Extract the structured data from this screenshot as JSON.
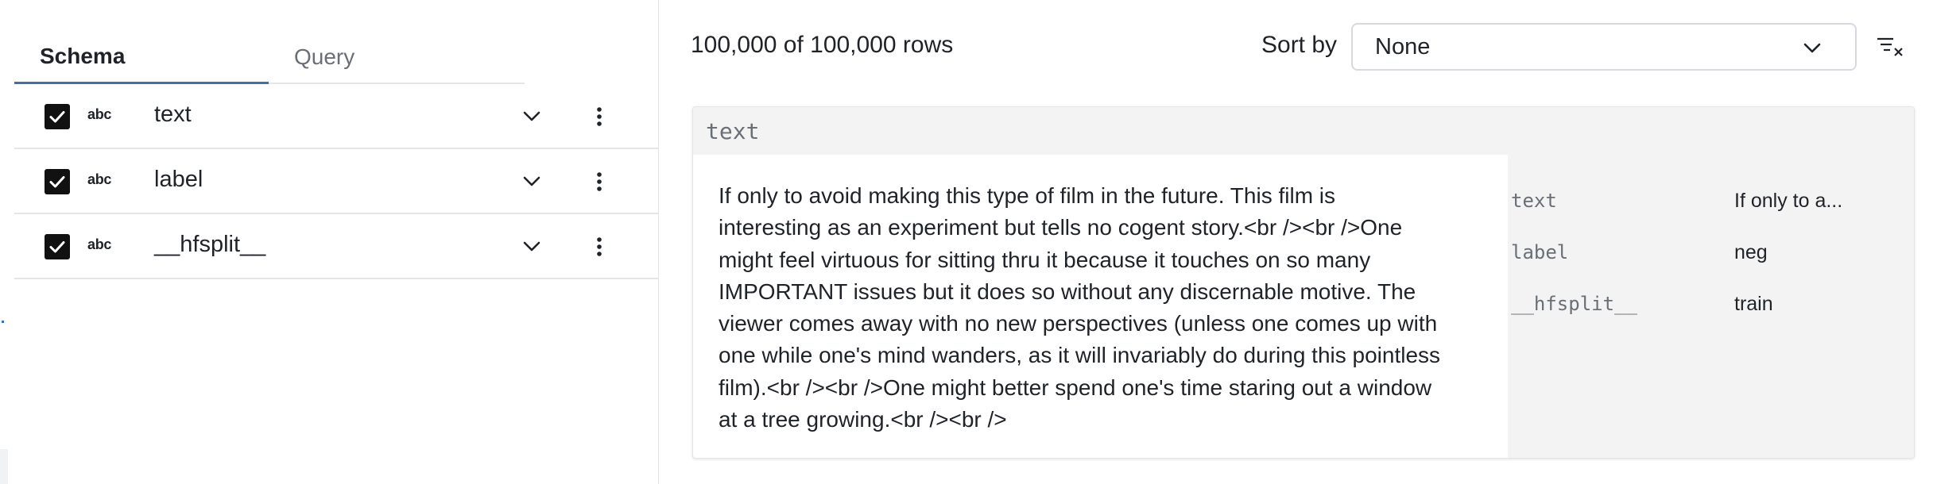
{
  "tabs": [
    {
      "label": "Schema",
      "active": true
    },
    {
      "label": "Query",
      "active": false
    }
  ],
  "fields": [
    {
      "type_icon": "abc",
      "name": "text",
      "checked": true
    },
    {
      "type_icon": "abc",
      "name": "label",
      "checked": true
    },
    {
      "type_icon": "abc",
      "name": "__hfsplit__",
      "checked": true
    }
  ],
  "toolbar": {
    "row_count": "100,000 of 100,000 rows",
    "sort_label": "Sort by",
    "sort_value": "None"
  },
  "record": {
    "header": "text",
    "text": "If only to avoid making this type of film in the future. This film is interesting as an experiment but tells no cogent story.<br /><br />One might feel virtuous for sitting thru it because it touches on so many IMPORTANT issues but it does so without any discernable motive. The viewer comes away with no new perspectives (unless one comes up with one while one's mind wanders, as it will invariably do during this pointless film).<br /><br />One might better spend one's time staring out a window at a tree growing.<br /><br />",
    "fields": [
      {
        "key": "text",
        "value": "If only to a..."
      },
      {
        "key": "label",
        "value": "neg"
      },
      {
        "key": "__hfsplit__",
        "value": "train"
      }
    ]
  },
  "colors": {
    "accent": "#3b6fb6",
    "border": "#e3e5e8",
    "panel_gray": "#f3f3f3",
    "muted_text": "#6a6f76"
  },
  "icons": {
    "checkbox": "checkbox-checked-icon",
    "expand": "chevron-down-icon",
    "menu": "more-vertical-icon",
    "clear_sort": "clear-sort-icon"
  }
}
